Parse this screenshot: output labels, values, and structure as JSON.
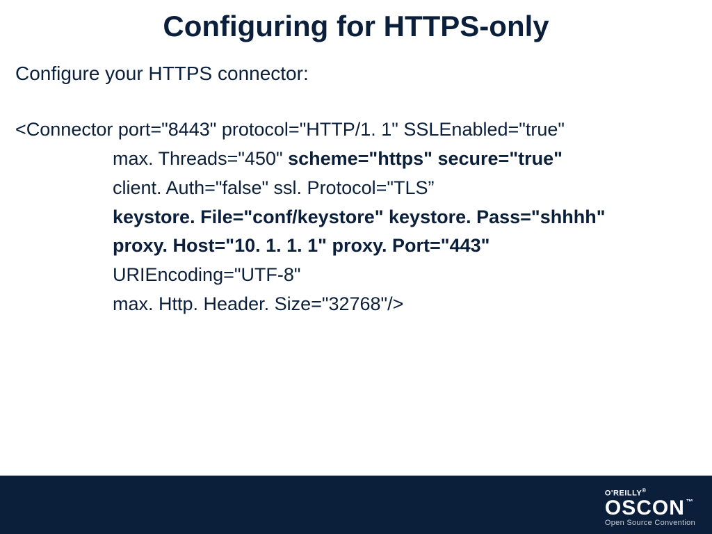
{
  "title": "Configuring for HTTPS-only",
  "subtitle": "Configure your HTTPS connector:",
  "code": {
    "l1a": "<Connector port=\"8443\" protocol=\"HTTP/1. 1\" SSLEnabled=\"true\"",
    "l2a": "max. Threads=\"450\" ",
    "l2b": "scheme=\"https\" secure=\"true\"",
    "l3": "client. Auth=\"false\" ssl. Protocol=\"TLS”",
    "l4": "keystore. File=\"conf/keystore\" keystore. Pass=\"shhhh\"",
    "l5": "proxy. Host=\"10. 1. 1. 1\" proxy. Port=\"443\"",
    "l6": "URIEncoding=\"UTF-8\"",
    "l7": "max. Http. Header. Size=\"32768\"/>"
  },
  "footer": {
    "brand_top": "O'REILLY",
    "brand_main": "OSCON",
    "brand_sub": "Open Source Convention"
  }
}
